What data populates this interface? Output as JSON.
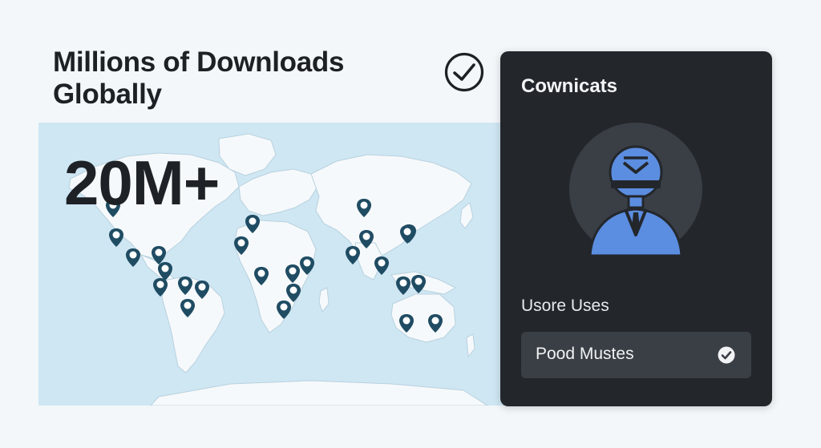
{
  "hero": {
    "headline_line1": "Millions of Downloads",
    "headline_line2": "Globally",
    "stat": "20M+"
  },
  "icons": {
    "top_check": "check-circle-icon",
    "map_marker": "map-pin-smiley-icon",
    "avatar": "person-avatar-icon",
    "option_check": "check-circle-filled-icon"
  },
  "panel": {
    "title": "Cownicats",
    "section_label": "Usore Uses",
    "option": {
      "label": "Pood Mustes",
      "selected": true
    }
  },
  "colors": {
    "background": "#f3f7fa",
    "ocean": "#cfe6f3",
    "land": "#f6f9fb",
    "marker": "#1f4c63",
    "panel": "#23272c",
    "avatar_accent": "#5b8de0"
  }
}
